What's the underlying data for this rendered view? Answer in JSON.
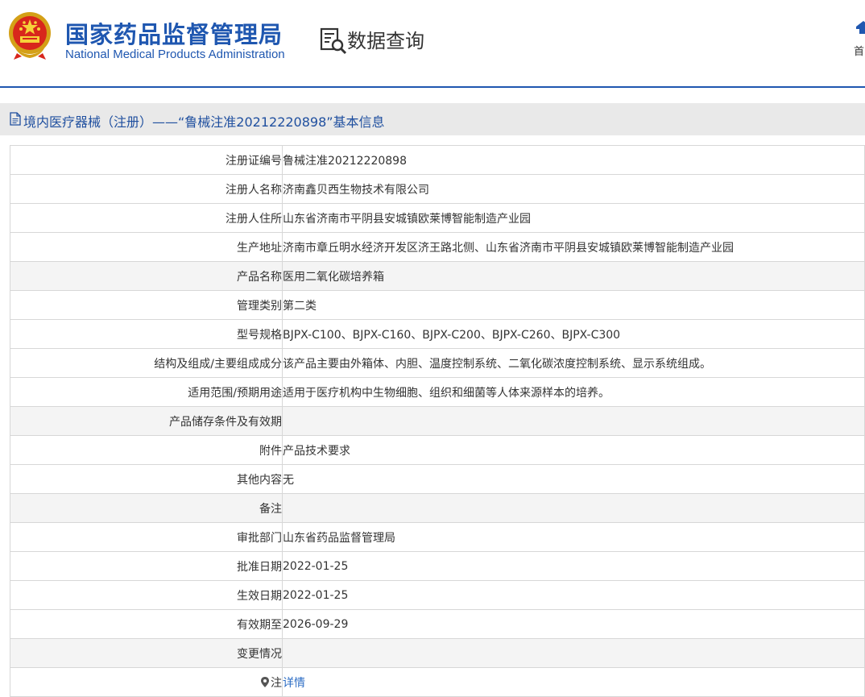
{
  "header": {
    "brand_cn": "国家药品监督管理局",
    "brand_en": "National Medical Products Administration",
    "data_query": "数据查询",
    "home": "首"
  },
  "page_title": "境内医疗器械（注册）——“鲁械注准20212220898”基本信息",
  "rows": [
    {
      "label": "注册证编号",
      "value": "鲁械注准20212220898"
    },
    {
      "label": "注册人名称",
      "value": "济南鑫贝西生物技术有限公司"
    },
    {
      "label": "注册人住所",
      "value": "山东省济南市平阴县安城镇欧莱博智能制造产业园"
    },
    {
      "label": "生产地址",
      "value": "济南市章丘明水经济开发区济王路北侧、山东省济南市平阴县安城镇欧莱博智能制造产业园"
    },
    {
      "label": "产品名称",
      "value": "医用二氧化碳培养箱"
    },
    {
      "label": "管理类别",
      "value": "第二类"
    },
    {
      "label": "型号规格",
      "value": "BJPX-C100、BJPX-C160、BJPX-C200、BJPX-C260、BJPX-C300"
    },
    {
      "label": "结构及组成/主要组成成分",
      "value": "该产品主要由外箱体、内胆、温度控制系统、二氧化碳浓度控制系统、显示系统组成。"
    },
    {
      "label": "适用范围/预期用途",
      "value": "适用于医疗机构中生物细胞、组织和细菌等人体来源样本的培养。"
    },
    {
      "label": "产品储存条件及有效期",
      "value": ""
    },
    {
      "label": "附件",
      "value": "产品技术要求"
    },
    {
      "label": "其他内容",
      "value": "无"
    },
    {
      "label": "备注",
      "value": ""
    },
    {
      "label": "审批部门",
      "value": "山东省药品监督管理局"
    },
    {
      "label": "批准日期",
      "value": "2022-01-25"
    },
    {
      "label": "生效日期",
      "value": "2022-01-25"
    },
    {
      "label": "有效期至",
      "value": "2026-09-29"
    },
    {
      "label": "变更情况",
      "value": ""
    }
  ],
  "note": {
    "label": "注",
    "link": "详情"
  },
  "colors": {
    "brand": "#1f57b0",
    "link": "#2b6cc4",
    "title_bg": "#e9e9e9",
    "row_alt": "#f4f4f4"
  }
}
